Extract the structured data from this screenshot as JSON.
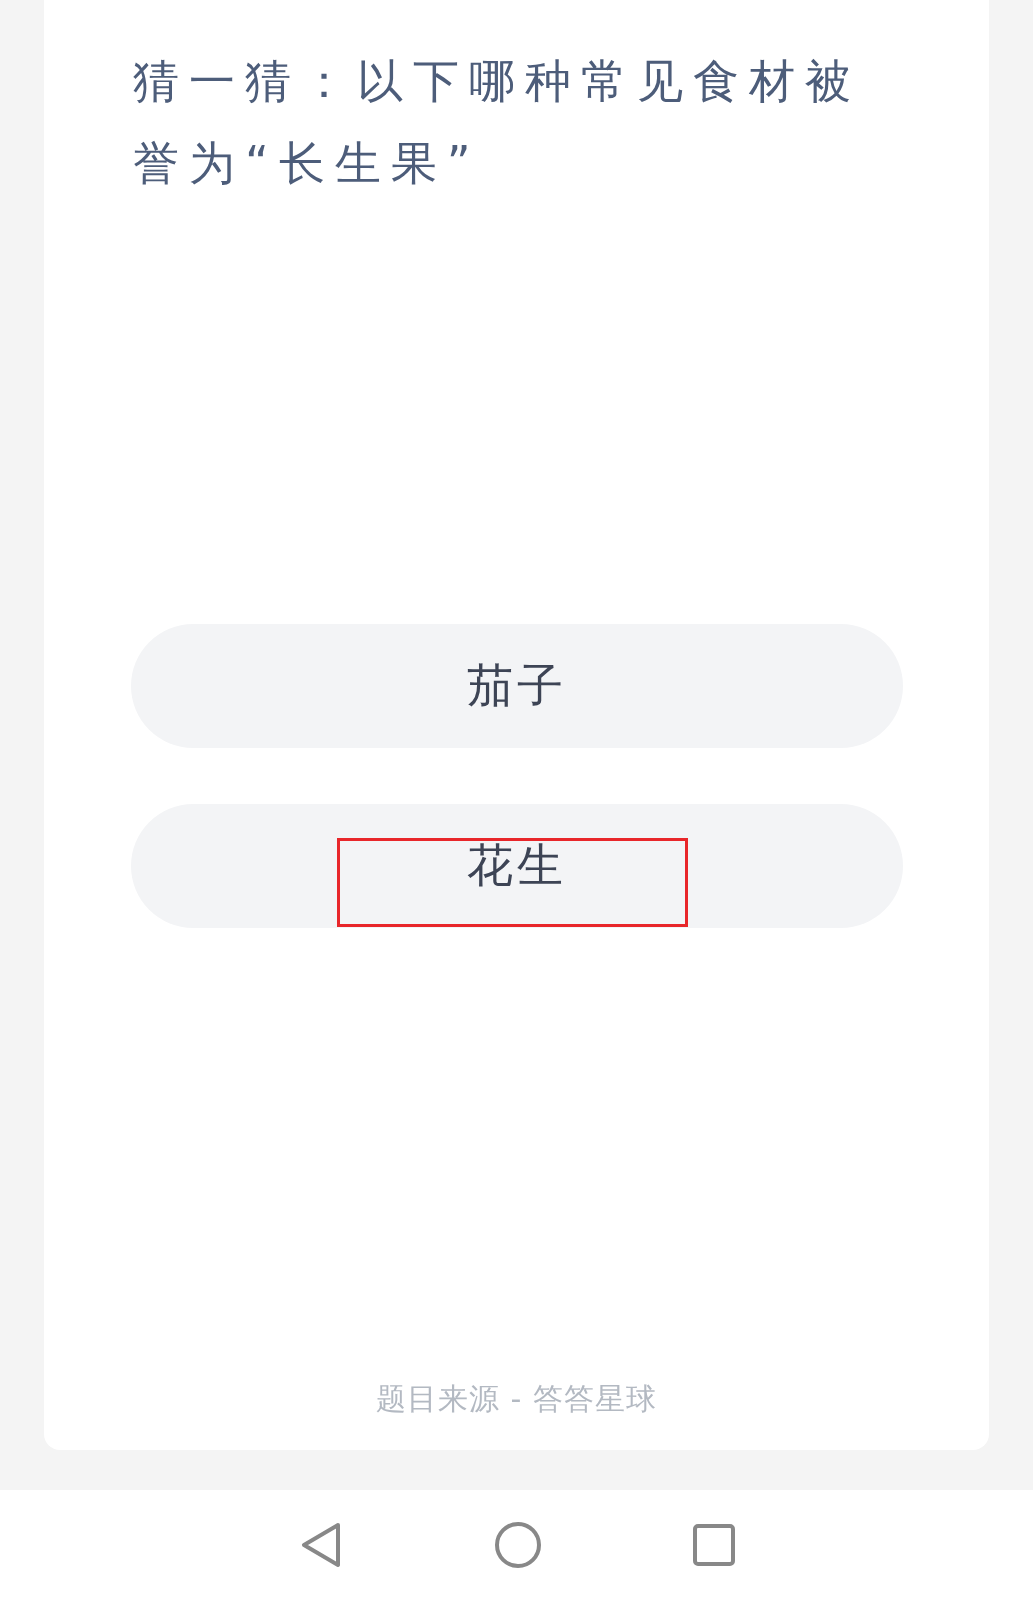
{
  "question": "猜一猜：以下哪种常见食材被誉为“长生果”",
  "options": [
    {
      "label": "茄子",
      "highlighted": false
    },
    {
      "label": "花生",
      "highlighted": true
    }
  ],
  "source": "题目来源 - 答答星球",
  "nav_bar": {
    "buttons": [
      {
        "kind": "back"
      },
      {
        "kind": "home"
      },
      {
        "kind": "recents"
      }
    ]
  }
}
